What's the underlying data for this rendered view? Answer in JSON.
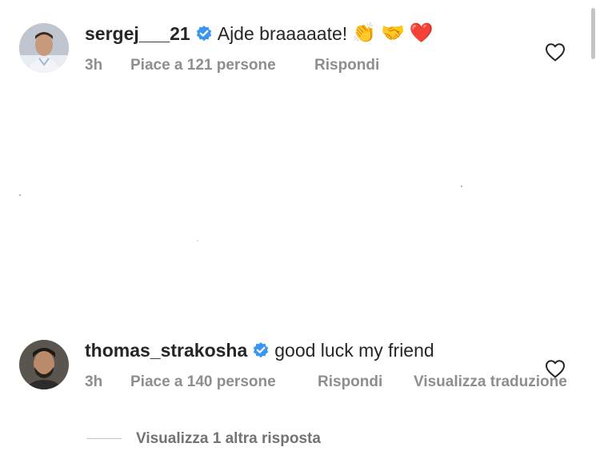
{
  "comments": [
    {
      "username": "sergej___21",
      "verified": true,
      "text": "Ajde braaaaate!",
      "emojis": [
        "👏",
        "🤝",
        "❤️"
      ],
      "time": "3h",
      "likes_label": "Piace a 121 persone",
      "reply_label": "Rispondi",
      "liked": false
    },
    {
      "username": "thomas_strakosha",
      "verified": true,
      "text": "good luck my friend",
      "time": "3h",
      "likes_label": "Piace a 140 persone",
      "reply_label": "Rispondi",
      "translate_label": "Visualizza traduzione",
      "view_replies_label": "Visualizza 1 altra risposta",
      "liked": false
    }
  ],
  "colors": {
    "text": "#262626",
    "secondary": "#8e8e8e",
    "verified_blue": "#3897f0",
    "divider": "#c7c7c7"
  },
  "icons": {
    "verified": "verified-badge-icon",
    "like": "heart-outline-icon",
    "avatar": "profile-photo"
  }
}
